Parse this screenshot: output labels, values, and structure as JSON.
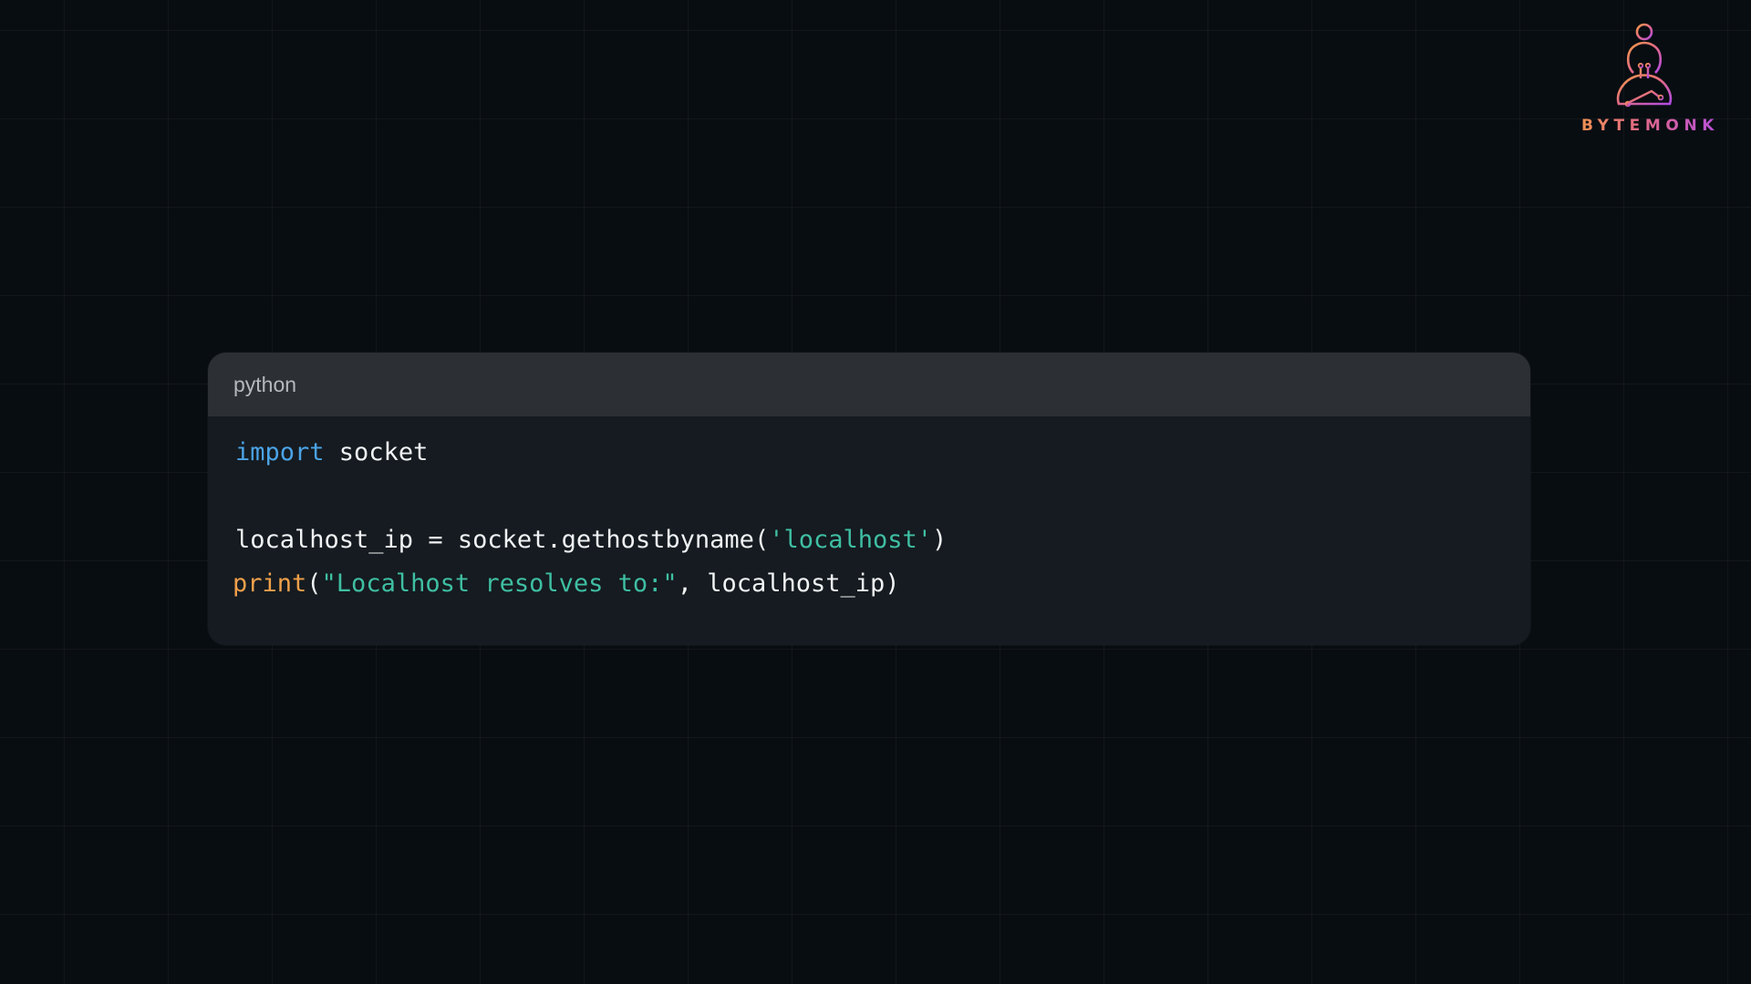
{
  "brand": {
    "name": "BYTEMONK",
    "logo_icon": "monk-meditating-circuit-icon",
    "gradient": [
      "#f29a45",
      "#e26a86",
      "#b04be5"
    ]
  },
  "code_block": {
    "language": "python",
    "lines": [
      {
        "tokens": [
          {
            "text": "import",
            "kind": "keyword"
          },
          {
            "text": " socket",
            "kind": "plain"
          }
        ]
      },
      {
        "tokens": []
      },
      {
        "tokens": [
          {
            "text": "localhost_ip = socket.gethostbyname(",
            "kind": "plain"
          },
          {
            "text": "'localhost'",
            "kind": "string"
          },
          {
            "text": ")",
            "kind": "plain"
          }
        ]
      },
      {
        "tokens": [
          {
            "text": "print",
            "kind": "function"
          },
          {
            "text": "(",
            "kind": "plain"
          },
          {
            "text": "\"Localhost resolves to:\"",
            "kind": "string"
          },
          {
            "text": ", localhost_ip)",
            "kind": "plain"
          }
        ]
      }
    ]
  },
  "colors": {
    "background": "#080d12",
    "card": "#151b20",
    "card_header": "#2c3035",
    "keyword": "#4ba3e6",
    "function": "#f0a04b",
    "string": "#3fbfa3",
    "text": "#f1f3f5"
  }
}
